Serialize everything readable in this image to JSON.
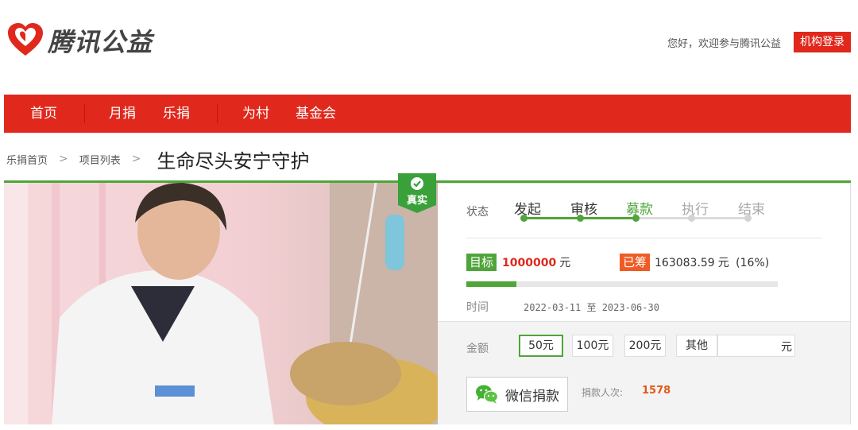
{
  "colors": {
    "brand_red": "#e0281c",
    "accent_green": "#4fa53a",
    "raised_orange": "#f05a24"
  },
  "header": {
    "logo_text": "腾讯公益",
    "logo_icon": "heart-logo-icon",
    "welcome": "您好，欢迎参与腾讯公益",
    "org_login": "机构登录"
  },
  "nav": {
    "items": [
      "首页",
      "月捐",
      "乐捐",
      "为村",
      "基金会"
    ]
  },
  "breadcrumb": {
    "home": "乐捐首页",
    "list": "项目列表",
    "title": "生命尽头安宁守护"
  },
  "verified_badge": {
    "label": "真实",
    "icon": "check-icon"
  },
  "project": {
    "status_label": "状态",
    "steps": [
      "发起",
      "审核",
      "募款",
      "执行",
      "结束"
    ],
    "current_step_index": 2,
    "target_tag": "目标",
    "target_value": "1000000",
    "unit": "元",
    "raised_tag": "已筹",
    "raised_value": "163083.59",
    "raised_percent": "(16%)",
    "progress_fraction": 0.16,
    "time_label": "时间",
    "dates": "2022-03-11 至 2023-06-30"
  },
  "donate": {
    "amount_label": "金额",
    "options": [
      "50元",
      "100元",
      "200元",
      "其他"
    ],
    "selected_index": 0,
    "custom_unit": "元",
    "wechat_button": "微信捐款",
    "wechat_icon": "wechat-icon",
    "donor_label": "捐款人次:",
    "donor_count": "1578"
  }
}
